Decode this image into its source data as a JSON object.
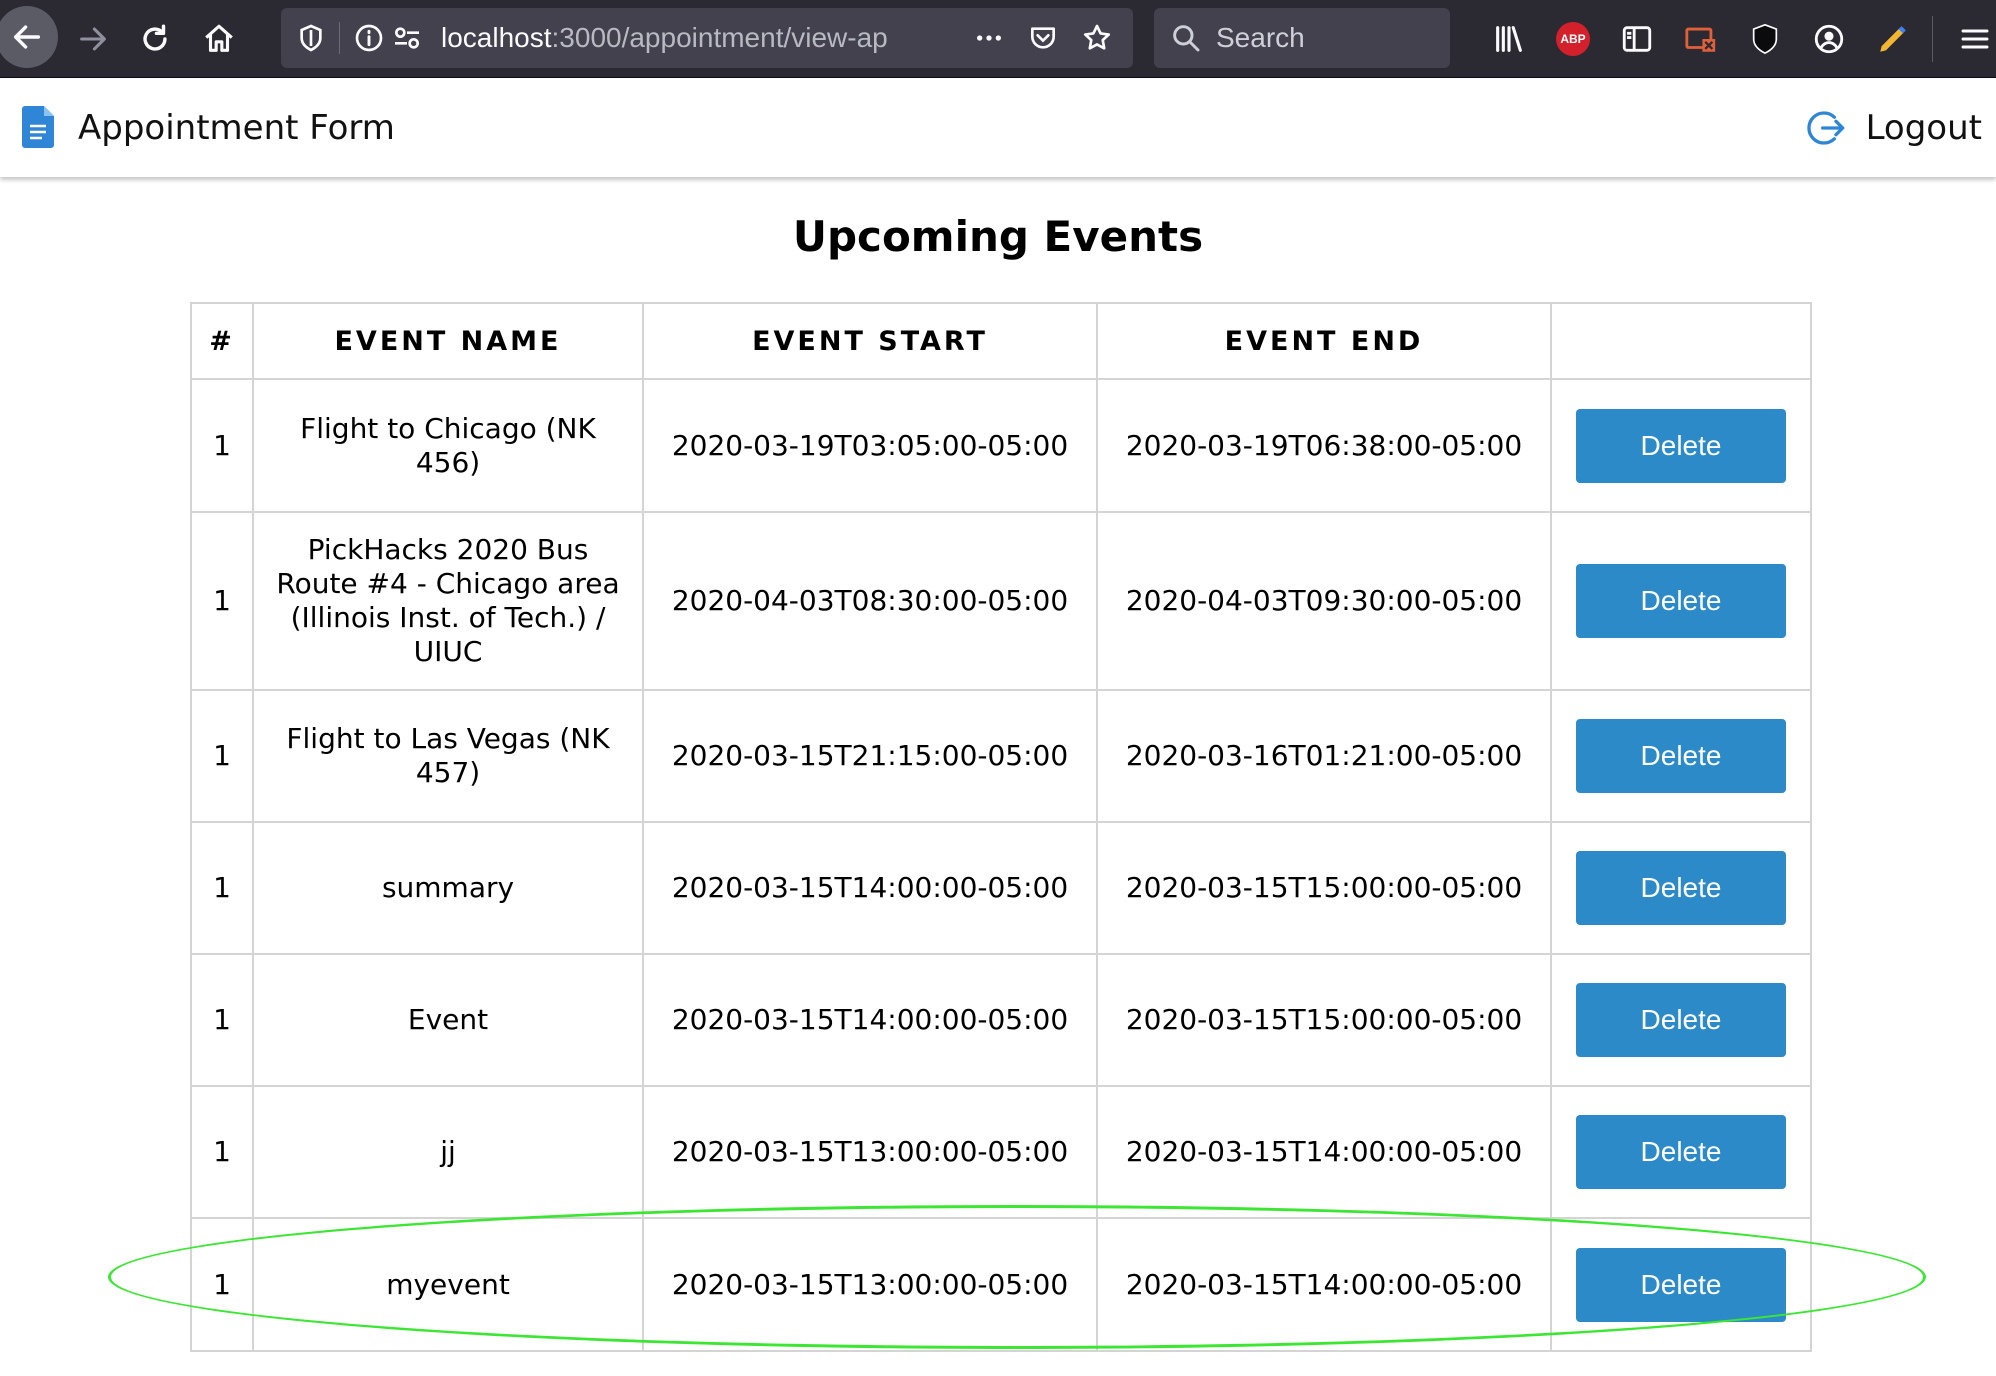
{
  "browser": {
    "url_host": "localhost",
    "url_path": ":3000/appointment/view-ap",
    "search_placeholder": "Search",
    "abp_label": "ABP"
  },
  "app": {
    "title": "Appointment Form",
    "logout_label": "Logout"
  },
  "page": {
    "title": "Upcoming Events"
  },
  "table": {
    "headers": [
      "#",
      "EVENT NAME",
      "EVENT START",
      "EVENT END",
      ""
    ],
    "delete_label": "Delete",
    "rows": [
      {
        "num": "1",
        "name": "Flight to Chicago (NK 456)",
        "start": "2020-03-19T03:05:00-05:00",
        "end": "2020-03-19T06:38:00-05:00"
      },
      {
        "num": "1",
        "name": "PickHacks 2020 Bus Route #4 - Chicago area (Illinois Inst. of Tech.) / UIUC",
        "start": "2020-04-03T08:30:00-05:00",
        "end": "2020-04-03T09:30:00-05:00"
      },
      {
        "num": "1",
        "name": "Flight to Las Vegas (NK 457)",
        "start": "2020-03-15T21:15:00-05:00",
        "end": "2020-03-16T01:21:00-05:00"
      },
      {
        "num": "1",
        "name": "summary",
        "start": "2020-03-15T14:00:00-05:00",
        "end": "2020-03-15T15:00:00-05:00"
      },
      {
        "num": "1",
        "name": "Event",
        "start": "2020-03-15T14:00:00-05:00",
        "end": "2020-03-15T15:00:00-05:00"
      },
      {
        "num": "1",
        "name": "jj",
        "start": "2020-03-15T13:00:00-05:00",
        "end": "2020-03-15T14:00:00-05:00"
      },
      {
        "num": "1",
        "name": "myevent",
        "start": "2020-03-15T13:00:00-05:00",
        "end": "2020-03-15T14:00:00-05:00"
      }
    ]
  },
  "colors": {
    "accent": "#2b8ac7",
    "highlight": "#3ce633",
    "chrome_bg": "#2b2a33"
  }
}
